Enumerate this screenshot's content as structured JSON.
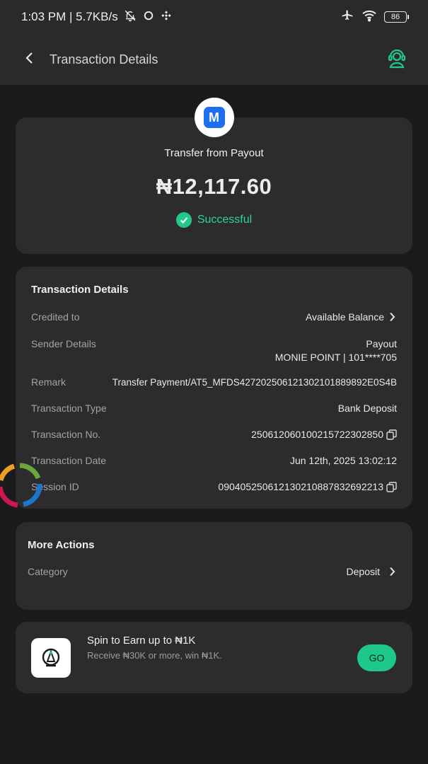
{
  "status_bar": {
    "time_speed": "1:03 PM | 5.7KB/s",
    "battery": "86"
  },
  "header": {
    "title": "Transaction Details",
    "back_icon": "chevron-left-icon",
    "support_icon": "customer-support-icon"
  },
  "summary": {
    "logo_letter": "M",
    "title": "Transfer from Payout",
    "amount": "₦12,117.60",
    "status": "Successful",
    "status_color": "#2bd69a"
  },
  "details": {
    "section_title": "Transaction Details",
    "credited_to": {
      "label": "Credited to",
      "value": "Available Balance"
    },
    "sender": {
      "label": "Sender Details",
      "name": "Payout",
      "account": "MONIE POINT | 101****705"
    },
    "remark": {
      "label": "Remark",
      "value": "Transfer Payment/AT5_MFDS427202506121302101889892E0S4B"
    },
    "type": {
      "label": "Transaction Type",
      "value": "Bank Deposit"
    },
    "number": {
      "label": "Transaction No.",
      "value": "250612060100215722302850"
    },
    "date": {
      "label": "Transaction Date",
      "value": "Jun 12th, 2025 13:02:12"
    },
    "session": {
      "label": "Session ID",
      "value": "090405250612130210887832692213"
    }
  },
  "more_actions": {
    "section_title": "More Actions",
    "category": {
      "label": "Category",
      "value": "Deposit"
    }
  },
  "promo": {
    "title": "Spin to Earn up to ₦1K",
    "subtitle": "Receive ₦30K or more, win ₦1K.",
    "button": "GO",
    "accent": "#1ec78a"
  }
}
